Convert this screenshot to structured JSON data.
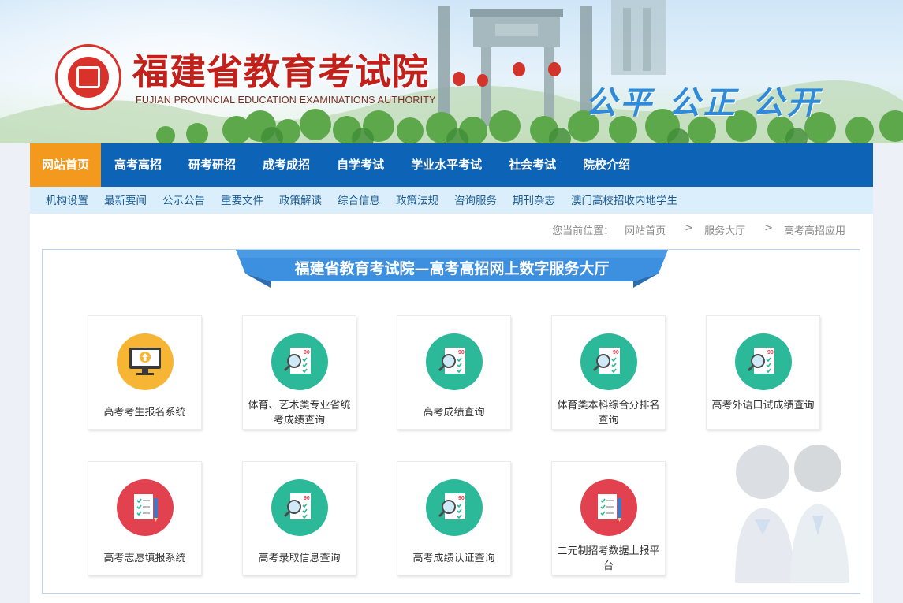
{
  "header": {
    "title_cn": "福建省教育考试院",
    "title_en": "FUJIAN PROVINCIAL EDUCATION EXAMINATIONS AUTHORITY",
    "slogan": "公平 公正 公开"
  },
  "main_nav": [
    {
      "label": "网站首页",
      "active": true
    },
    {
      "label": "高考高招"
    },
    {
      "label": "研考研招"
    },
    {
      "label": "成考成招"
    },
    {
      "label": "自学考试"
    },
    {
      "label": "学业水平考试"
    },
    {
      "label": "社会考试"
    },
    {
      "label": "院校介绍"
    }
  ],
  "sub_nav": [
    {
      "label": "机构设置"
    },
    {
      "label": "最新要闻"
    },
    {
      "label": "公示公告"
    },
    {
      "label": "重要文件"
    },
    {
      "label": "政策解读"
    },
    {
      "label": "综合信息"
    },
    {
      "label": "政策法规"
    },
    {
      "label": "咨询服务"
    },
    {
      "label": "期刊杂志"
    },
    {
      "label": "澳门高校招收内地学生"
    }
  ],
  "breadcrumb": {
    "prefix": "您当前位置：",
    "items": [
      "网站首页",
      "服务大厅",
      "高考高招应用"
    ],
    "separator": ">"
  },
  "panel": {
    "title": "福建省教育考试院—高考高招网上数字服务大厅"
  },
  "cards": [
    {
      "label": "高考考生报名系统",
      "icon": "computer-upload-icon"
    },
    {
      "label": "体育、艺术类专业省统考成绩查询",
      "icon": "score-search-icon"
    },
    {
      "label": "高考成绩查询",
      "icon": "score-search-icon"
    },
    {
      "label": "体育类本科综合分排名查询",
      "icon": "score-search-icon"
    },
    {
      "label": "高考外语口试成绩查询",
      "icon": "score-search-icon"
    },
    {
      "label": "高考志愿填报系统",
      "icon": "checklist-pencil-icon"
    },
    {
      "label": "高考录取信息查询",
      "icon": "score-search-icon"
    },
    {
      "label": "高考成绩认证查询",
      "icon": "score-search-icon"
    },
    {
      "label": "二元制招考数据上报平台",
      "icon": "checklist-pencil-icon"
    }
  ],
  "colors": {
    "nav_blue": "#0d63b6",
    "nav_active_orange": "#f39a1e",
    "subnav_bg": "#dbeefb",
    "title_red": "#c2201b",
    "slogan_blue": "#2f8bd8",
    "icon_teal": "#2cb99a",
    "icon_yellow": "#f7b535",
    "icon_red": "#e2414f"
  }
}
